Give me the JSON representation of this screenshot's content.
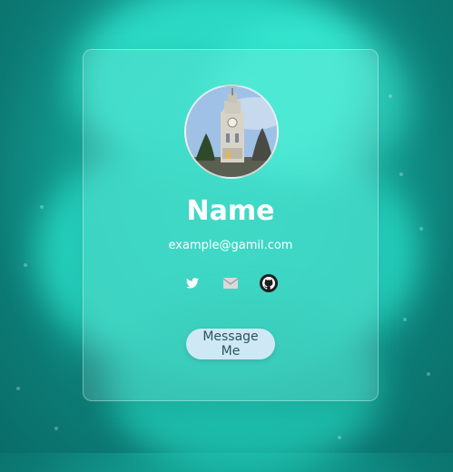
{
  "profile": {
    "name": "Name",
    "email": "example@gamil.com",
    "avatar_alt": "clock tower photo"
  },
  "socials": [
    {
      "icon": "twitter-icon"
    },
    {
      "icon": "mail-icon"
    },
    {
      "icon": "github-icon"
    }
  ],
  "actions": {
    "message_label": "Message Me"
  },
  "colors": {
    "background": "#149e92",
    "button_bg": "#cfe8f6",
    "button_text": "#27565f"
  }
}
